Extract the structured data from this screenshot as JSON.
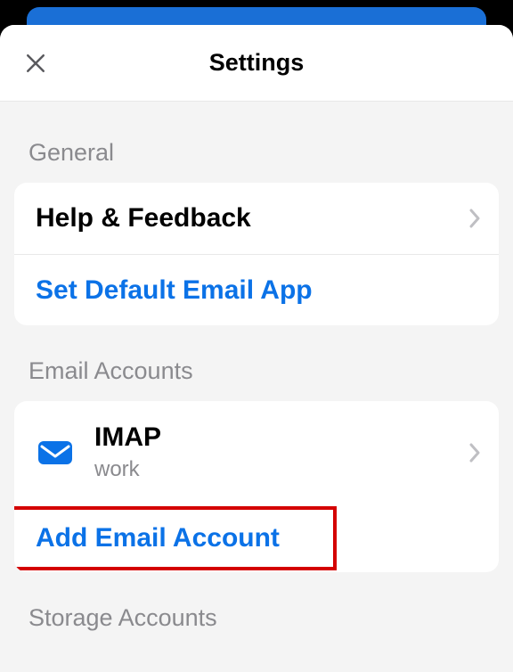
{
  "header": {
    "title": "Settings"
  },
  "sections": {
    "general": {
      "title": "General",
      "help_label": "Help & Feedback",
      "default_app_label": "Set Default Email App"
    },
    "email_accounts": {
      "title": "Email Accounts",
      "account": {
        "title": "IMAP",
        "subtitle": "work"
      },
      "add_label": "Add Email Account"
    },
    "storage_accounts": {
      "title": "Storage Accounts"
    }
  },
  "colors": {
    "accent": "#0b72e7",
    "section_header": "#8a8a8e",
    "highlight": "#d40000"
  }
}
